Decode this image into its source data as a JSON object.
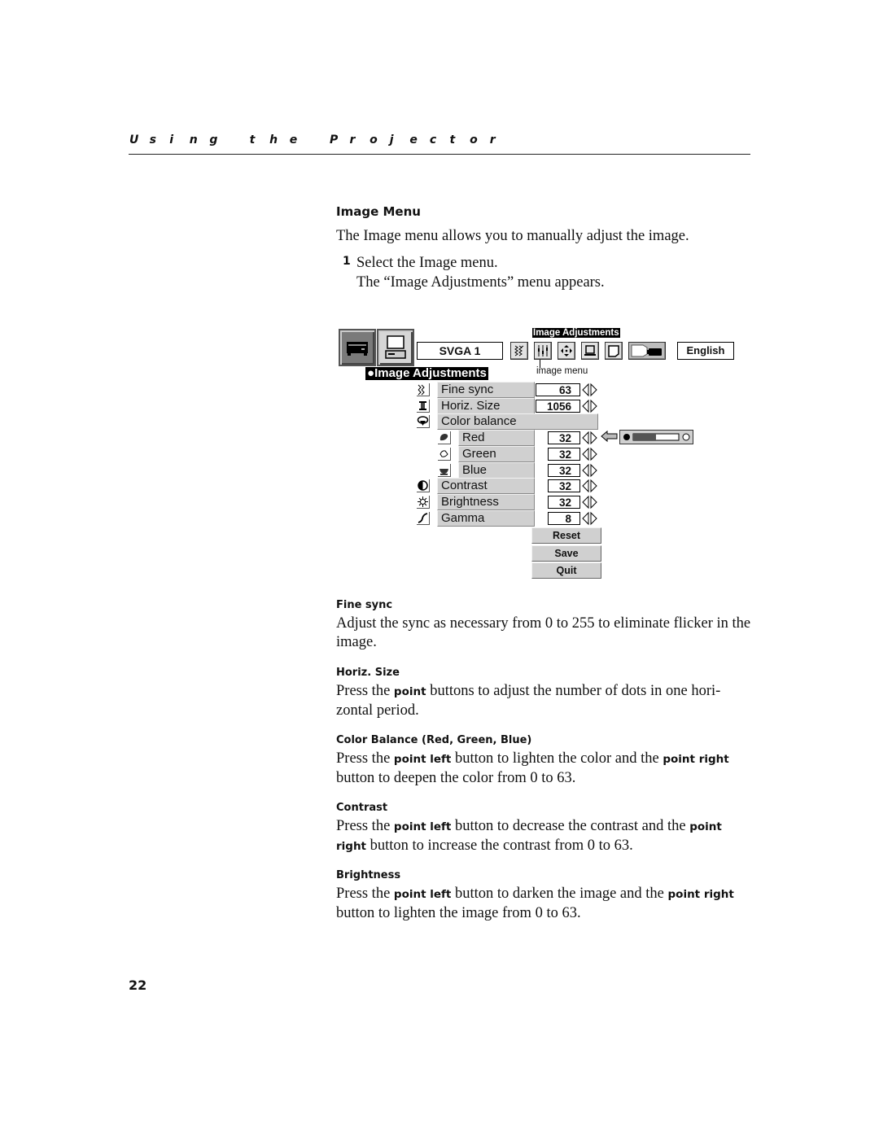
{
  "running_header": [
    "U",
    "s",
    "i",
    "n",
    "g",
    " ",
    "t",
    "h",
    "e",
    " ",
    "P",
    "r",
    "o",
    "j",
    "e",
    "c",
    "t",
    "o",
    "r"
  ],
  "section_title": "Image Menu",
  "intro": "The Image menu allows you to manually adjust the image.",
  "steps": [
    {
      "number": "1",
      "text": "Select the Image menu.",
      "result": "The “Image Adjustments” menu appears."
    }
  ],
  "osd": {
    "source_buttons": [
      {
        "icon": "video-player-icon",
        "state": "selected"
      },
      {
        "icon": "computer-icon",
        "state": "normal"
      }
    ],
    "source_label": "SVGA 1",
    "toolbar_title": "Image Adjustments",
    "toolbar_icons": [
      "sync-wave-icon",
      "image-sliders-icon",
      "position-arrows-icon",
      "monitor-icon",
      "screen-icon",
      "projector-screen-icon"
    ],
    "language": "English",
    "tooltip": "image menu",
    "menu_title": "Image Adjustments",
    "rows": [
      {
        "label": "Fine sync",
        "value": "63",
        "icon": "fine-sync-icon",
        "indent": false,
        "has_value": true
      },
      {
        "label": "Horiz. Size",
        "value": "1056",
        "icon": "horiz-size-icon",
        "indent": false,
        "has_value": true
      },
      {
        "label": "Color balance",
        "value": null,
        "icon": "color-balance-icon",
        "indent": false,
        "has_value": false
      },
      {
        "label": "Red",
        "value": "32",
        "icon": "red-icon",
        "indent": true,
        "has_value": true
      },
      {
        "label": "Green",
        "value": "32",
        "icon": "green-icon",
        "indent": true,
        "has_value": true
      },
      {
        "label": "Blue",
        "value": "32",
        "icon": "blue-icon",
        "indent": true,
        "has_value": true
      },
      {
        "label": "Contrast",
        "value": "32",
        "icon": "contrast-icon",
        "indent": false,
        "has_value": true
      },
      {
        "label": "Brightness",
        "value": "32",
        "icon": "brightness-icon",
        "indent": false,
        "has_value": true
      },
      {
        "label": "Gamma",
        "value": "8",
        "icon": "gamma-icon",
        "indent": false,
        "has_value": true
      }
    ],
    "red_slider_level": 0.5,
    "buttons": [
      "Reset",
      "Save",
      "Quit"
    ]
  },
  "descriptions": [
    {
      "heading": "Fine sync",
      "parts": [
        {
          "t": "Adjust the sync as necessary from 0 to 255 to eliminate flicker in the image.",
          "b": false
        }
      ]
    },
    {
      "heading": "Horiz. Size",
      "parts": [
        {
          "t": "Press the ",
          "b": false
        },
        {
          "t": "point",
          "b": true
        },
        {
          "t": " buttons to adjust the number of dots in one hori-zontal period.",
          "b": false
        }
      ]
    },
    {
      "heading": "Color Balance (Red, Green, Blue)",
      "parts": [
        {
          "t": "Press the ",
          "b": false
        },
        {
          "t": "point left",
          "b": true
        },
        {
          "t": " button to lighten the color and the ",
          "b": false
        },
        {
          "t": "point right",
          "b": true
        },
        {
          "t": " button to deepen the color from 0 to 63.",
          "b": false
        }
      ]
    },
    {
      "heading": "Contrast",
      "parts": [
        {
          "t": "Press the ",
          "b": false
        },
        {
          "t": "point left",
          "b": true
        },
        {
          "t": " button to decrease the contrast and the ",
          "b": false
        },
        {
          "t": "point right",
          "b": true
        },
        {
          "t": " button to increase the contrast from 0 to 63.",
          "b": false
        }
      ]
    },
    {
      "heading": "Brightness",
      "parts": [
        {
          "t": "Press the ",
          "b": false
        },
        {
          "t": "point left",
          "b": true
        },
        {
          "t": " button to darken the image and the ",
          "b": false
        },
        {
          "t": "point right",
          "b": true
        },
        {
          "t": " button to lighten the image from 0 to 63.",
          "b": false
        }
      ]
    }
  ],
  "page_number": "22"
}
